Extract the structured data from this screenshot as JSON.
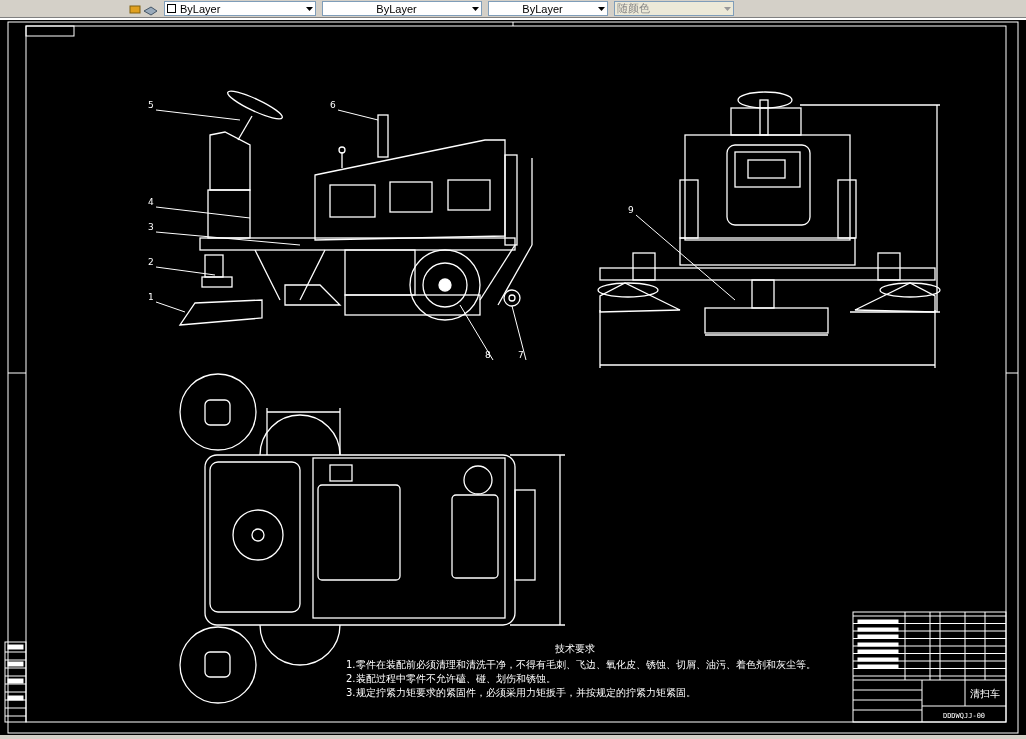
{
  "toolbar": {
    "dropdowns": [
      {
        "value": "ByLayer",
        "disabled": false
      },
      {
        "value": "ByLayer",
        "disabled": false
      },
      {
        "value": "ByLayer",
        "disabled": false
      },
      {
        "value": "随颜色",
        "disabled": true
      }
    ]
  },
  "drawing": {
    "balloons": [
      "5",
      "4",
      "3",
      "2",
      "1",
      "6",
      "8",
      "7",
      "9"
    ],
    "notes": {
      "title": "技术要求",
      "lines": [
        "1.零件在装配前必须清理和清洗干净，不得有毛刺、飞边、氧化皮、锈蚀、切屑、油污、着色剂和灰尘等。",
        "2.装配过程中零件不允许磕、碰、划伤和锈蚀。",
        "3.规定拧紧力矩要求的紧固件，必须采用力矩扳手，并按规定的拧紧力矩紧固。"
      ]
    },
    "title_block": {
      "name": "清扫车",
      "drawing_number": "DDDWQJJ-00"
    }
  }
}
